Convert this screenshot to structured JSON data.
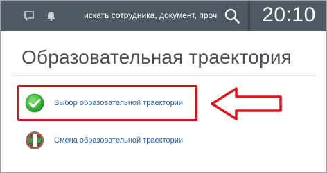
{
  "header": {
    "search_placeholder": "искать сотрудника, документ, проч",
    "time": "20:10",
    "icons": [
      "chat-icon",
      "bell-icon",
      "search-icon"
    ]
  },
  "page": {
    "title": "Образовательная траектория"
  },
  "items": [
    {
      "label": "Выбор образовательной траектории",
      "icon": "green-check-icon",
      "highlighted": true
    },
    {
      "label": "Смена образовательной траектории",
      "icon": "swap-icon",
      "highlighted": false
    }
  ],
  "colors": {
    "topbar": "#4e5963",
    "highlight": "#d8141c",
    "link": "#2e5f9a",
    "check_green": "#3cb83c",
    "swap_brown": "#8b5a4a"
  }
}
